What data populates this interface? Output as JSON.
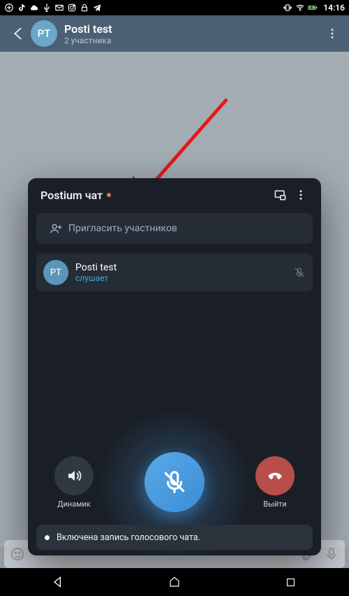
{
  "status": {
    "time": "14:16"
  },
  "header": {
    "avatar": "PT",
    "title": "Posti test",
    "subtitle": "2 участника"
  },
  "voice_chat": {
    "title": "Postium чат",
    "invite_label": "Пригласить участников",
    "participants": [
      {
        "avatar": "PT",
        "name": "Posti test",
        "status": "слушает"
      }
    ],
    "speaker_label": "Динамик",
    "leave_label": "Выйти",
    "recording_banner": "Включена запись голосового чата."
  }
}
